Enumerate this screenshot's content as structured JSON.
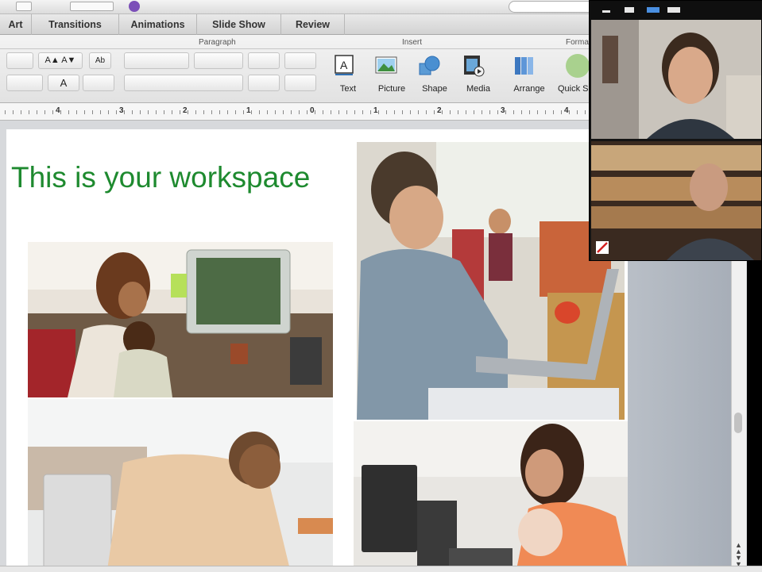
{
  "tabs": [
    "Art",
    "Transitions",
    "Animations",
    "Slide Show",
    "Review"
  ],
  "ribbon": {
    "groups": {
      "paragraph": "Paragraph",
      "insert": "Insert",
      "format": "Forma"
    },
    "insert_buttons": [
      "Text",
      "Picture",
      "Shape",
      "Media",
      "Arrange",
      "Quick S"
    ],
    "format_glyphs": {
      "font_size_up": "A▲",
      "font_size_down": "A▼",
      "clear": "Ab",
      "font_color": "A"
    }
  },
  "ruler": {
    "numbers": [
      "4",
      "3",
      "2",
      "1",
      "0",
      "1",
      "2",
      "3",
      "4"
    ]
  },
  "slide": {
    "title": "This is your workspace"
  },
  "video_call": {
    "participants": 2
  },
  "colors": {
    "title_green": "#1e8a2f",
    "accent_blue": "#2e6fb3",
    "panel_gray": "#b4bac3"
  }
}
